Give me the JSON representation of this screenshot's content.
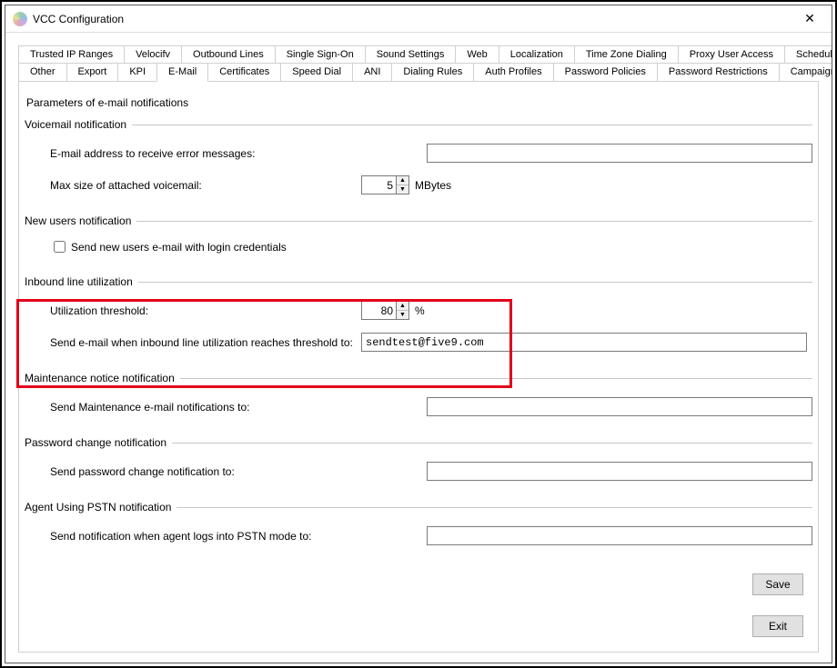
{
  "window": {
    "title": "VCC Configuration",
    "close_glyph": "✕"
  },
  "tabs_row1": [
    "Trusted IP Ranges",
    "Velocifv",
    "Outbound Lines",
    "Single Sign-On",
    "Sound Settings",
    "Web",
    "Localization",
    "Time Zone Dialing",
    "Proxy User Access",
    "Schedules"
  ],
  "tabs_row2": [
    "Other",
    "Export",
    "KPI",
    "E-Mail",
    "Certificates",
    "Speed Dial",
    "ANI",
    "Dialing Rules",
    "Auth Profiles",
    "Password Policies",
    "Password Restrictions",
    "Campaigns"
  ],
  "active_tab": "E-Mail",
  "page": {
    "heading": "Parameters of e-mail notifications",
    "voicemail": {
      "legend": "Voicemail notification",
      "addr_label": "E-mail address to receive error messages:",
      "addr_value": "",
      "size_label": "Max size of attached voicemail:",
      "size_value": "5",
      "size_unit": "MBytes"
    },
    "newusers": {
      "legend": "New users notification",
      "chk_label": "Send new users e-mail with login credentials",
      "chk_checked": false
    },
    "inbound": {
      "legend": "Inbound line utilization",
      "thresh_label": "Utilization threshold:",
      "thresh_value": "80",
      "thresh_unit": "%",
      "email_label": "Send e-mail when inbound line utilization reaches threshold to:",
      "email_value": "sendtest@five9.com"
    },
    "maintenance": {
      "legend": "Maintenance notice notification",
      "label": "Send Maintenance e-mail notifications to:",
      "value": ""
    },
    "password": {
      "legend": "Password change notification",
      "label": "Send password change notification to:",
      "value": ""
    },
    "pstn": {
      "legend": "Agent Using PSTN notification",
      "label": "Send notification when agent logs into PSTN mode to:",
      "value": ""
    }
  },
  "buttons": {
    "save": "Save",
    "exit": "Exit"
  }
}
